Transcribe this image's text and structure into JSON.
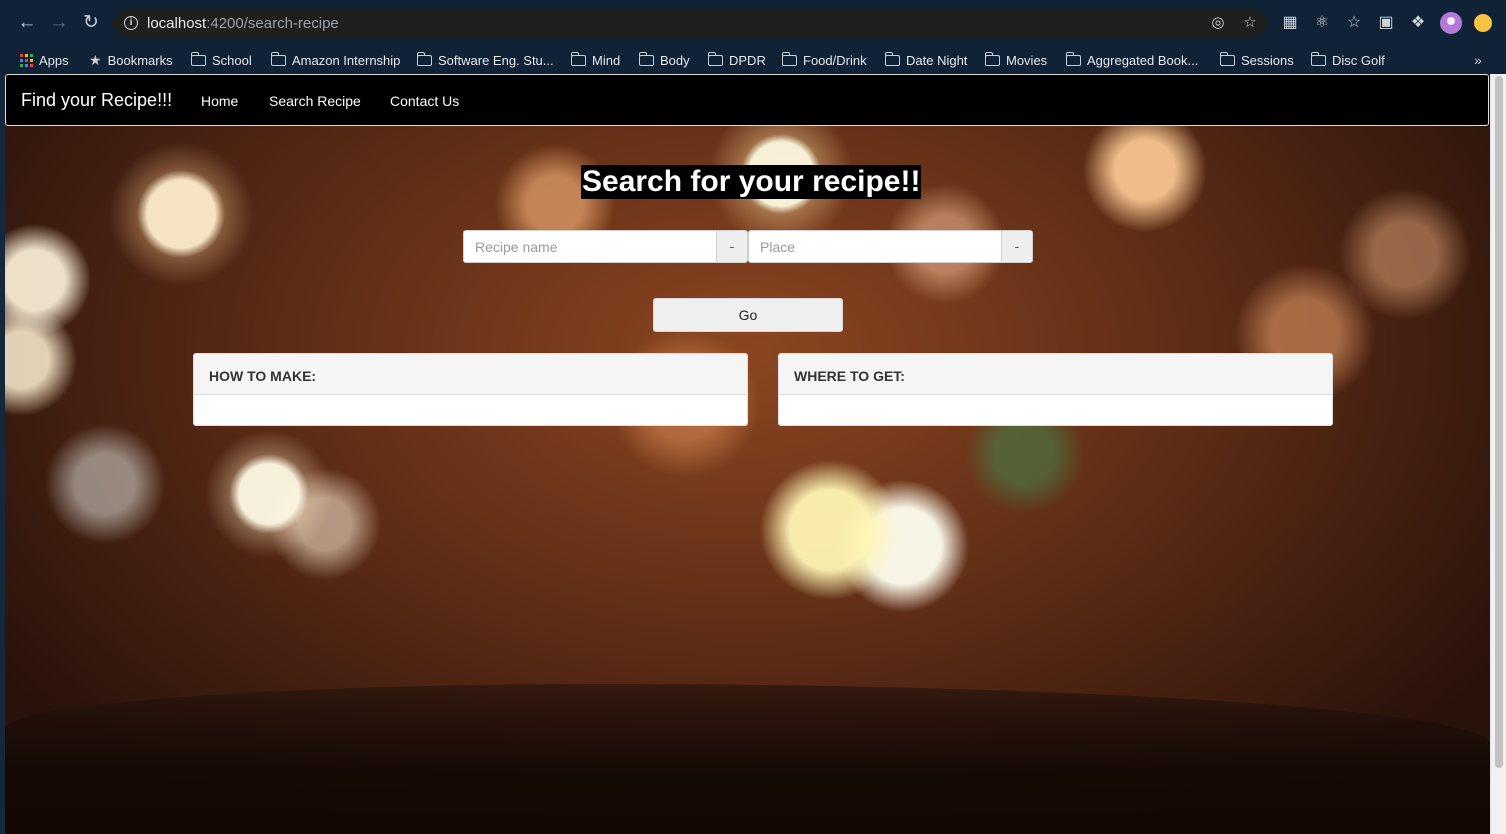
{
  "browser": {
    "url_host": "localhost",
    "url_path": ":4200/search-recipe",
    "bookmarks": [
      {
        "label": "Apps",
        "icon": "apps-grid-icon"
      },
      {
        "label": "Bookmarks",
        "icon": "star-icon"
      },
      {
        "label": "School",
        "icon": "folder-icon"
      },
      {
        "label": "Amazon Internship",
        "icon": "folder-icon"
      },
      {
        "label": "Software Eng. Stu...",
        "icon": "folder-icon"
      },
      {
        "label": "Mind",
        "icon": "folder-icon"
      },
      {
        "label": "Body",
        "icon": "folder-icon"
      },
      {
        "label": "DPDR",
        "icon": "folder-icon"
      },
      {
        "label": "Food/Drink",
        "icon": "folder-icon"
      },
      {
        "label": "Date Night",
        "icon": "folder-icon"
      },
      {
        "label": "Movies",
        "icon": "folder-icon"
      },
      {
        "label": "Aggregated Book...",
        "icon": "folder-icon"
      },
      {
        "label": "Sessions",
        "icon": "folder-icon"
      },
      {
        "label": "Disc Golf",
        "icon": "folder-icon"
      }
    ],
    "more_glyph": "»"
  },
  "navbar": {
    "brand": "Find your Recipe!!!",
    "links": [
      "Home",
      "Search Recipe",
      "Contact Us"
    ]
  },
  "search": {
    "heading": "Search for your recipe!!",
    "recipe_placeholder": "Recipe name",
    "recipe_addon": "-",
    "place_placeholder": "Place",
    "place_addon": "-",
    "go_label": "Go"
  },
  "panels": {
    "how_to_make": "HOW TO MAKE:",
    "where_to_get": "WHERE TO GET:"
  },
  "colors": {
    "chrome": "#0f2236",
    "navbar": "#000000",
    "panel_heading": "#f5f5f5"
  }
}
